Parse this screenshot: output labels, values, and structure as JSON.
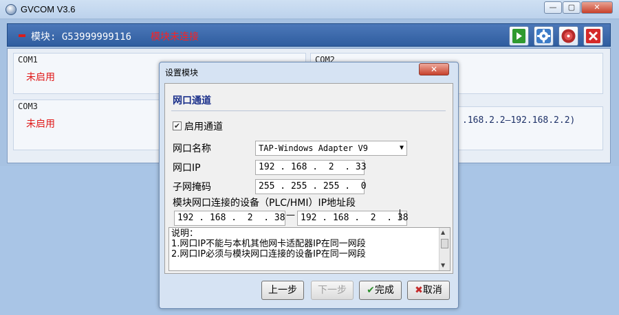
{
  "window": {
    "title": "GVCOM  V3.6",
    "minimize_label": "—",
    "restore_label": "▢",
    "close_label": "✕"
  },
  "module": {
    "label": "模块: G53999999116",
    "status": "模块未连接"
  },
  "toolbar": {
    "icons": [
      "play-icon",
      "gear-icon",
      "disc-icon",
      "close-icon"
    ],
    "colors": {
      "play": "#2f9a2f",
      "close": "#d52a2a"
    }
  },
  "com_ports": [
    {
      "name": "COM1",
      "status": "未启用"
    },
    {
      "name": "COM2",
      "status": ""
    },
    {
      "name": "COM3",
      "status": "未启用"
    }
  ],
  "com4_range_partial": ".168.2.2—192.168.2.2)",
  "dialog": {
    "title": "设置模块",
    "close_label": "✕",
    "section_title": "网口通道",
    "enable_checked": true,
    "enable_label": "启用通道",
    "nic_name_label": "网口名称",
    "nic_name_value": "TAP-Windows Adapter V9",
    "nic_ip_label": "网口IP",
    "nic_ip_value": "192 . 168 .  2  . 33",
    "subnet_label": "子网掩码",
    "subnet_value": "255 . 255 . 255 .  0",
    "range_label": "模块网口连接的设备（PLC/HMI）IP地址段",
    "range_start": "192 . 168 .  2  . 38",
    "range_end": "192 . 168 .  2  . 38",
    "notes": [
      "说明：",
      "1.网口IP不能与本机其他网卡适配器IP在同一网段",
      "2.网口IP必须与模块网口连接的设备IP在同一网段"
    ],
    "buttons": {
      "prev": "上一步",
      "next": "下一步",
      "finish": "完成",
      "cancel": "取消"
    }
  }
}
